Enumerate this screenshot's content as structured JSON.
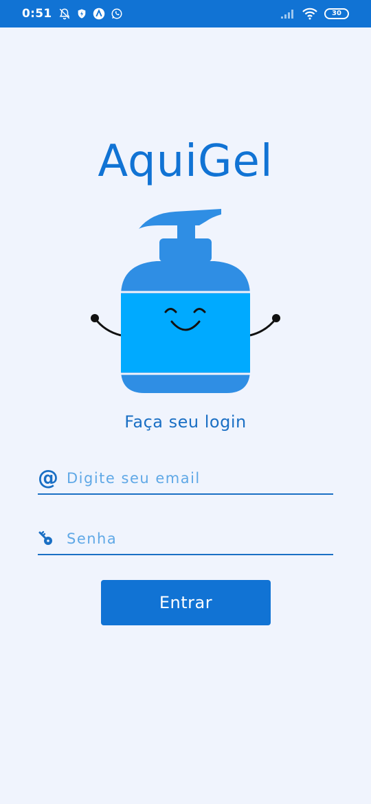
{
  "status_bar": {
    "time": "0:51",
    "battery_level": "30",
    "icons": [
      "bell-off-icon",
      "shield-icon",
      "vpn-icon",
      "whatsapp-icon",
      "signal-icon",
      "wifi-icon",
      "battery-icon"
    ]
  },
  "app": {
    "title": "AquiGel",
    "subtitle": "Faça seu login"
  },
  "form": {
    "email_placeholder": "Digite seu email",
    "email_value": "",
    "email_icon": "@",
    "password_placeholder": "Senha",
    "password_value": "",
    "password_icon": "key-icon",
    "submit_label": "Entrar"
  },
  "colors": {
    "primary": "#1173d4",
    "background": "#f0f4fd",
    "bottle_dark": "#2f8ee4",
    "bottle_light": "#00aaff",
    "placeholder": "#5fa8e6"
  }
}
